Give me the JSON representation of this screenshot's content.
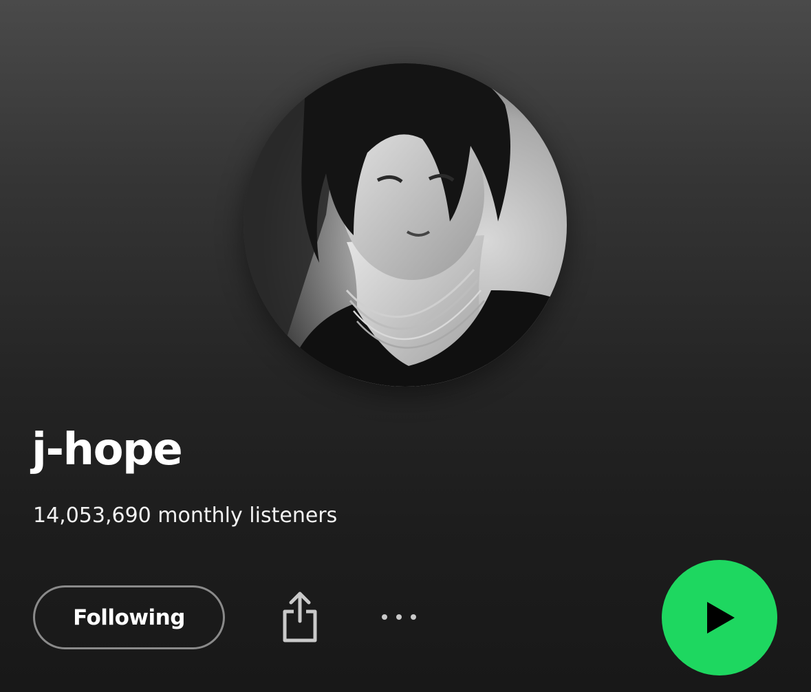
{
  "artist": {
    "name": "j-hope",
    "monthly_listeners": "14,053,690 monthly listeners",
    "image_icon": "artist-photo"
  },
  "actions": {
    "follow_label": "Following",
    "share_icon": "share-icon",
    "more_icon": "more-options-icon",
    "play_icon": "play-icon"
  },
  "colors": {
    "accent": "#1ed760",
    "background_top": "#4a4a4a",
    "background_bottom": "#181818",
    "follow_border": "#8a8a8a"
  }
}
